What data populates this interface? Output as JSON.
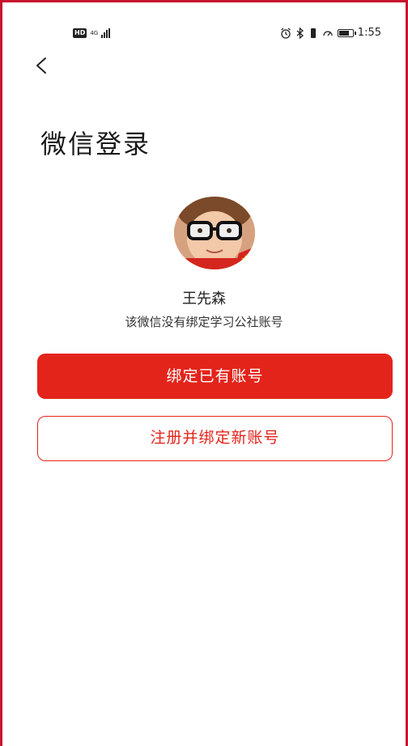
{
  "status_bar": {
    "left_badge": "HD",
    "network": "4G",
    "time": "1:55",
    "battery_level": 0.8,
    "icons": [
      "alarm-icon",
      "bluetooth-icon",
      "vibrate-icon",
      "data-saver-icon",
      "battery-icon"
    ]
  },
  "header": {
    "back_icon": "chevron-left-icon",
    "title": "微信登录"
  },
  "profile": {
    "avatar_icon": "avatar",
    "name": "王先森",
    "hint": "该微信没有绑定学习公社账号"
  },
  "actions": {
    "bind_existing": "绑定已有账号",
    "register_and_bind": "注册并绑定新账号"
  },
  "colors": {
    "accent": "#e3241b",
    "frame": "#c8102e"
  }
}
